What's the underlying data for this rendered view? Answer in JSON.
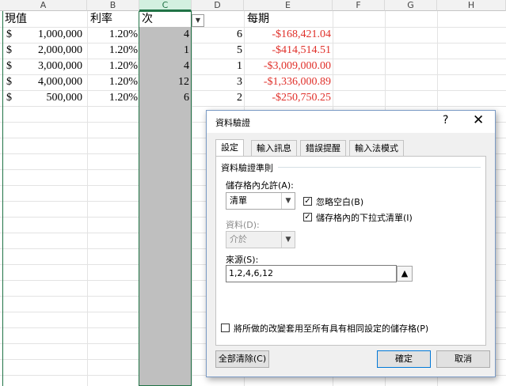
{
  "sheet": {
    "col_headers": [
      "A",
      "B",
      "C",
      "D",
      "E",
      "F",
      "G",
      "H"
    ],
    "headers": {
      "a": "現值",
      "b": "利率",
      "c": "次",
      "e": "每期"
    },
    "rows": [
      {
        "a_cur": "$",
        "a": "1,000,000",
        "b": "1.20%",
        "c": "4",
        "d": "6",
        "e": "-$168,421.04"
      },
      {
        "a_cur": "$",
        "a": "2,000,000",
        "b": "1.20%",
        "c": "1",
        "d": "5",
        "e": "-$414,514.51"
      },
      {
        "a_cur": "$",
        "a": "3,000,000",
        "b": "1.20%",
        "c": "4",
        "d": "1",
        "e": "-$3,009,000.00"
      },
      {
        "a_cur": "$",
        "a": "4,000,000",
        "b": "1.20%",
        "c": "12",
        "d": "3",
        "e": "-$1,336,000.89"
      },
      {
        "a_cur": "$",
        "a": "500,000",
        "b": "1.20%",
        "c": "6",
        "d": "2",
        "e": "-$250,750.25"
      }
    ],
    "dropdown_icon": "chevron-down-icon",
    "negative_color": "#e0302a",
    "selection_color": "#217346"
  },
  "dialog": {
    "title": "資料驗證",
    "help": "?",
    "close": "✕",
    "tabs": [
      "設定",
      "輸入訊息",
      "錯誤提醒",
      "輸入法模式"
    ],
    "criteria_label": "資料驗證準則",
    "allow_label": "儲存格內允許(A):",
    "allow_value": "清單",
    "data_label": "資料(D):",
    "data_value": "介於",
    "ignore_blank_label": "忽略空白(B)",
    "ignore_blank_checked": true,
    "in_cell_dropdown_label": "儲存格內的下拉式清單(I)",
    "in_cell_dropdown_checked": true,
    "source_label": "來源(S):",
    "source_value": "1,2,4,6,12",
    "apply_all_label": "將所做的改變套用至所有具有相同設定的儲存格(P)",
    "apply_all_checked": false,
    "clear_all": "全部清除(C)",
    "ok": "確定",
    "cancel": "取消"
  }
}
